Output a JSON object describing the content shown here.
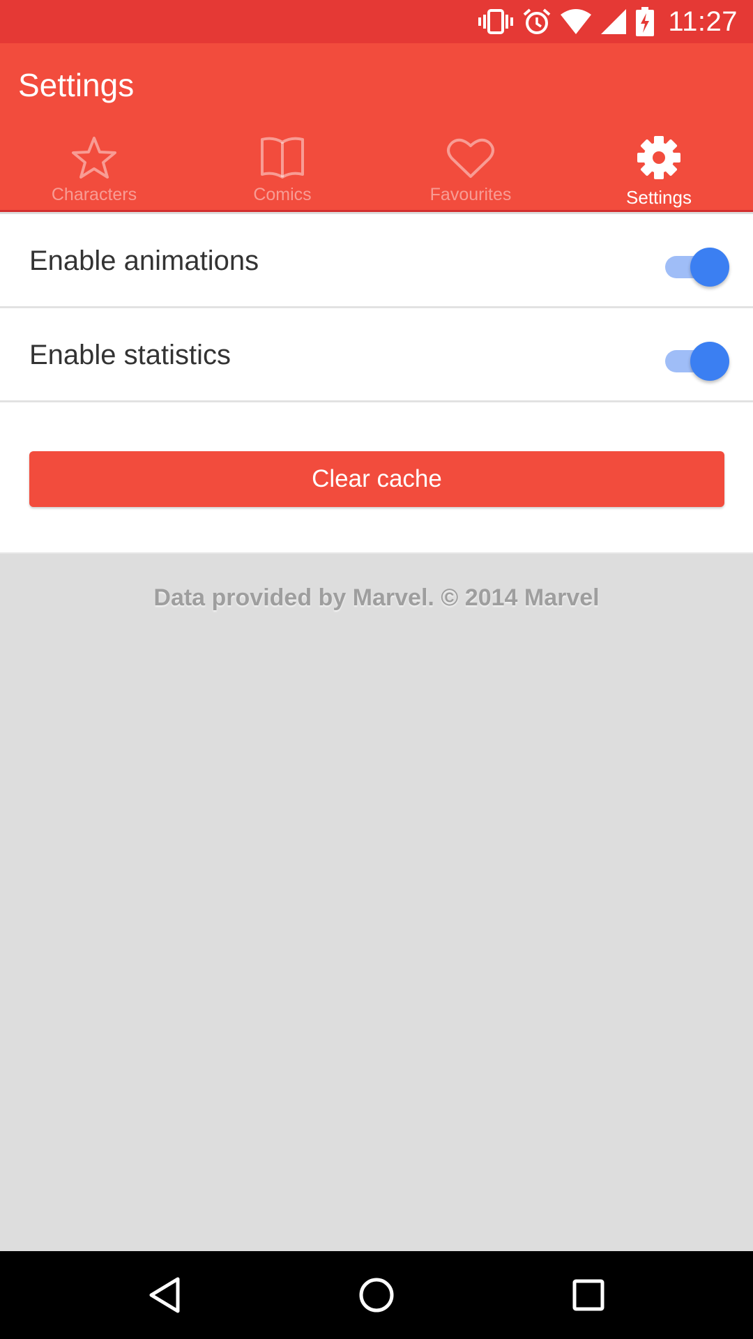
{
  "status_bar": {
    "time": "11:27",
    "icons": [
      "vibrate-icon",
      "alarm-icon",
      "wifi-icon",
      "signal-icon",
      "battery-charging-icon"
    ]
  },
  "app_bar": {
    "title": "Settings",
    "tabs": [
      {
        "label": "Characters",
        "icon": "star-icon",
        "active": false
      },
      {
        "label": "Comics",
        "icon": "book-icon",
        "active": false
      },
      {
        "label": "Favourites",
        "icon": "heart-icon",
        "active": false
      },
      {
        "label": "Settings",
        "icon": "gear-icon",
        "active": true
      }
    ]
  },
  "settings": {
    "items": [
      {
        "label": "Enable animations",
        "enabled": true
      },
      {
        "label": "Enable statistics",
        "enabled": true
      }
    ],
    "clear_cache_label": "Clear cache"
  },
  "footer": {
    "text": "Data provided by Marvel. © 2014 Marvel"
  },
  "nav_bar": {
    "buttons": [
      "back-icon",
      "home-icon",
      "recents-icon"
    ]
  },
  "colors": {
    "primary": "#f24c3d",
    "status_bar": "#e53935",
    "switch_on": "#3b7ff2",
    "background": "#dddddd"
  }
}
